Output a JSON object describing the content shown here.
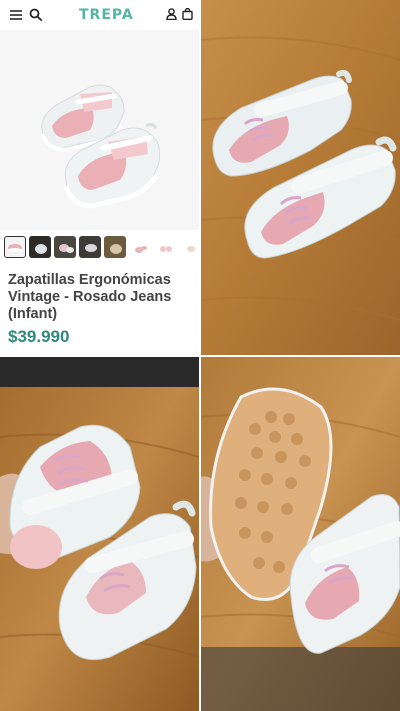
{
  "header": {
    "brand": "TREPA",
    "menu_icon": "hamburger-menu-icon",
    "search_icon": "search-icon",
    "account_icon": "user-icon",
    "cart_icon": "shopping-bag-icon"
  },
  "product": {
    "title": "Zapatillas Ergonómicas Vintage - Rosado Jeans (Infant)",
    "price": "$39.990",
    "thumbnail_count": 8
  },
  "colors": {
    "brand": "#57b5a4",
    "price": "#2e8a7a",
    "shoe_pink": "#e8aeb5",
    "shoe_white": "#eef2f2",
    "wood": "#b9823f"
  }
}
